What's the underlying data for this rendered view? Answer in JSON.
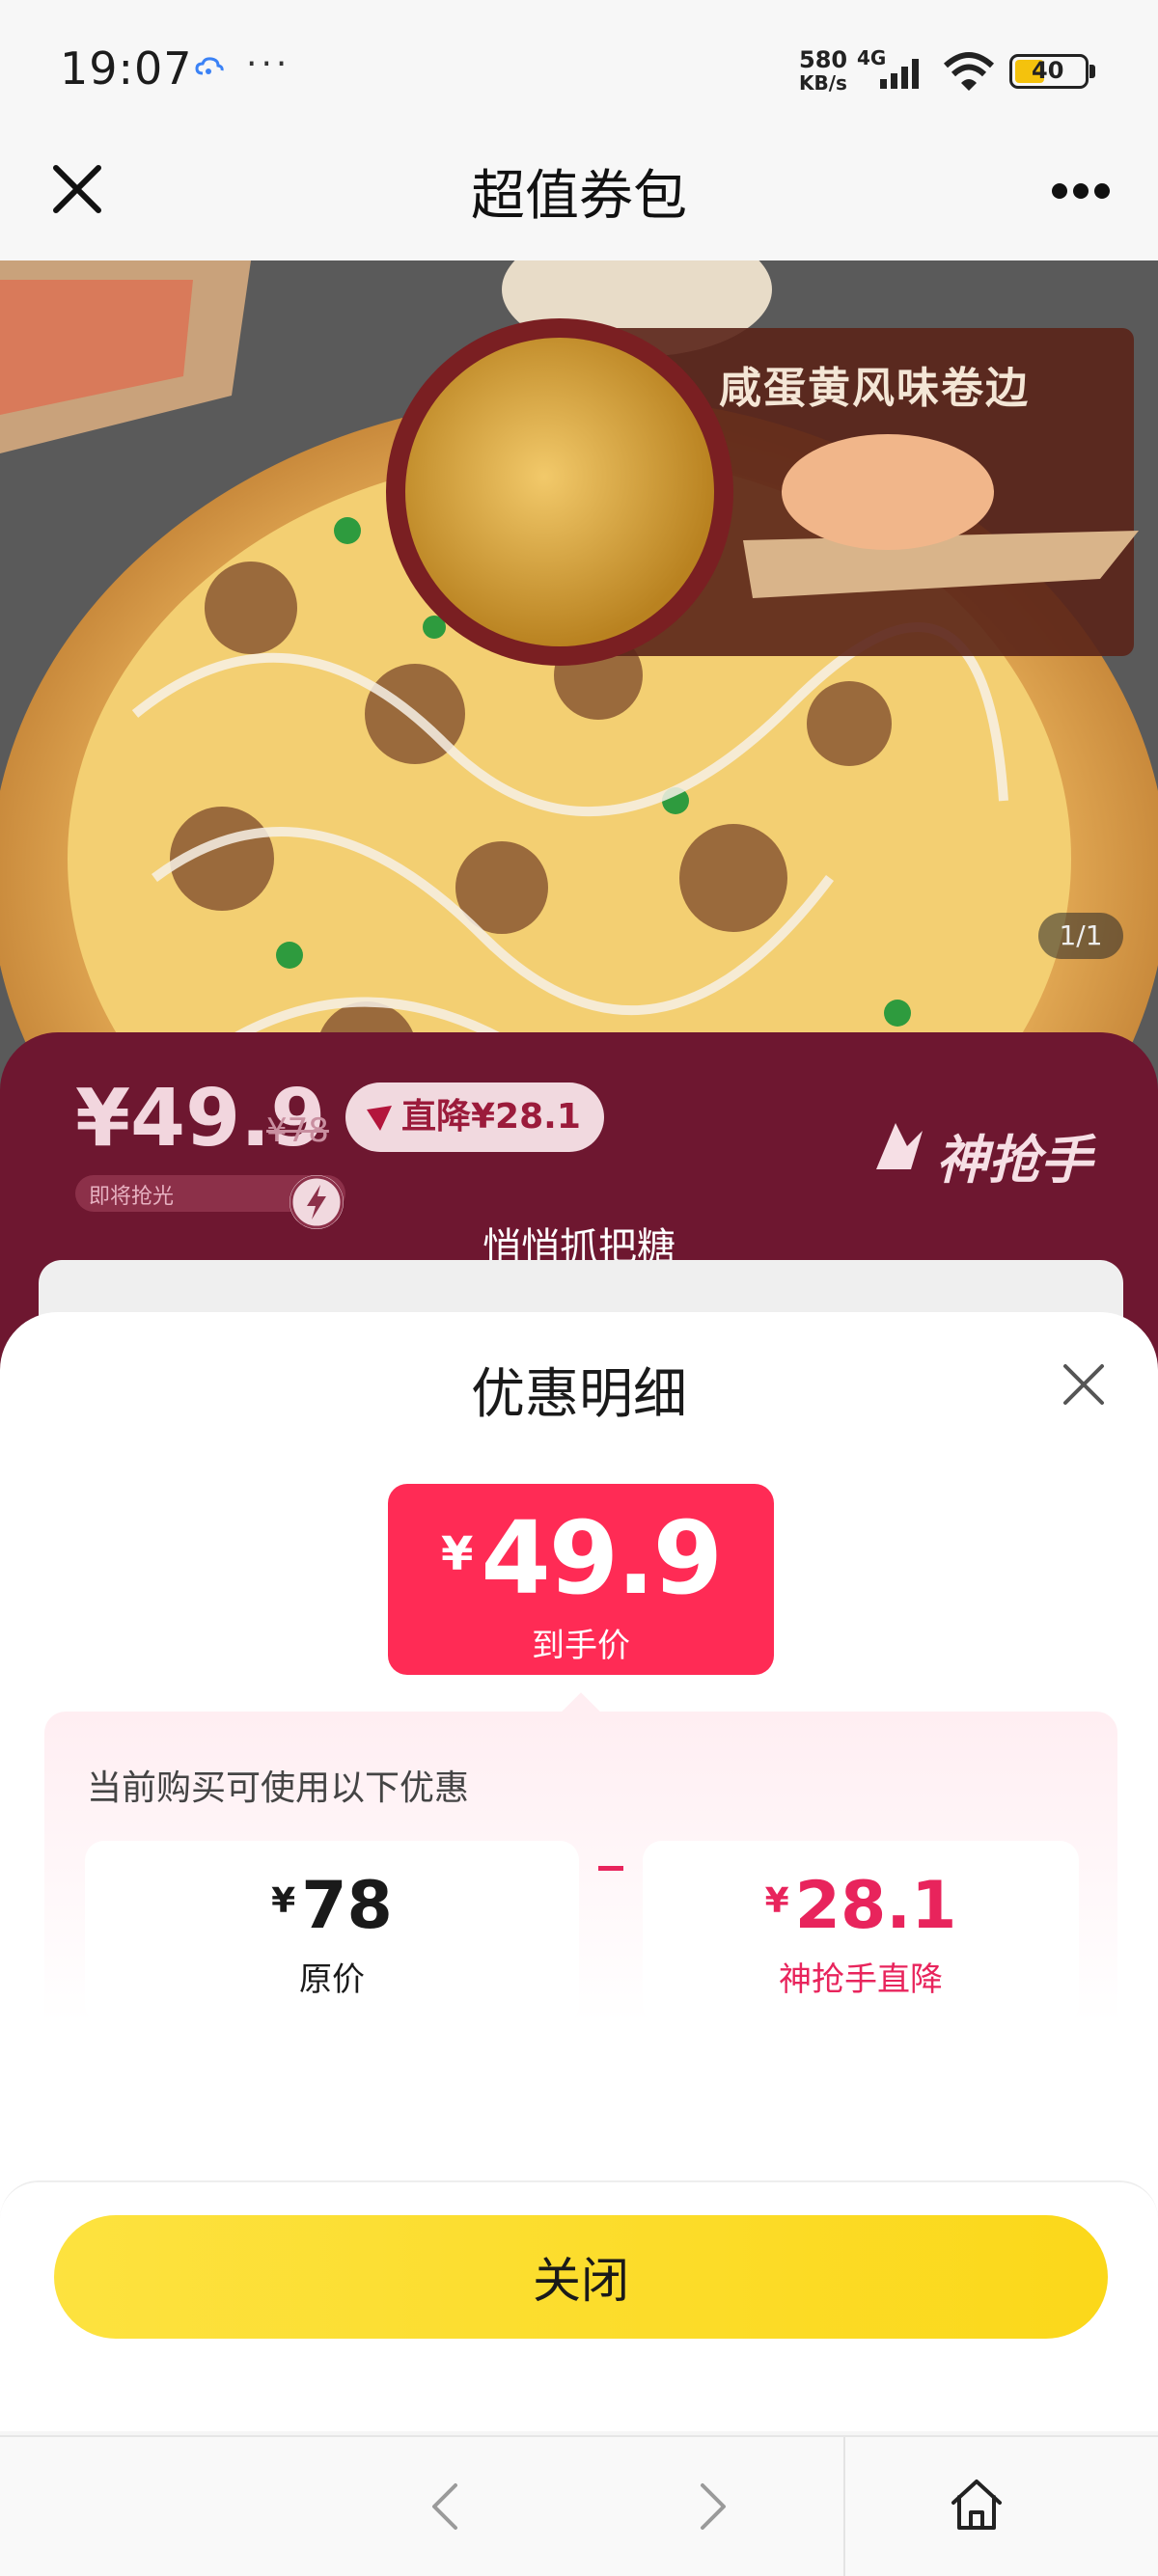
{
  "status_bar": {
    "time": "19:07",
    "dots": "···",
    "speed_value": "580",
    "speed_unit": "KB/s",
    "network": "4G",
    "battery": "40"
  },
  "nav": {
    "title": "超值券包",
    "close_icon": "close-icon",
    "more_icon": "more-icon"
  },
  "hero": {
    "caption": "咸蛋黄风味卷边",
    "counter": "1/1"
  },
  "banner": {
    "price": "¥49.9",
    "original_price": "¥78",
    "cut_label": "直降¥28.1",
    "stock_hint": "即将抢光",
    "brand": "神抢手",
    "slogan": "悄悄抓把糖"
  },
  "sheet": {
    "title": "优惠明细",
    "final_card": {
      "currency": "¥",
      "price": "49.9",
      "label": "到手价"
    },
    "detail": {
      "heading": "当前购买可使用以下优惠",
      "original": {
        "currency": "¥",
        "amount": "78",
        "label": "原价"
      },
      "operator": "-",
      "discount": {
        "currency": "¥",
        "amount": "28.1",
        "label": "神抢手直降"
      }
    },
    "close_button_label": "关闭"
  },
  "colors": {
    "accent_red": "#ff2b55",
    "discount_red": "#e8245c",
    "button_yellow": "#fde23f",
    "banner_maroon": "#6e1730"
  }
}
